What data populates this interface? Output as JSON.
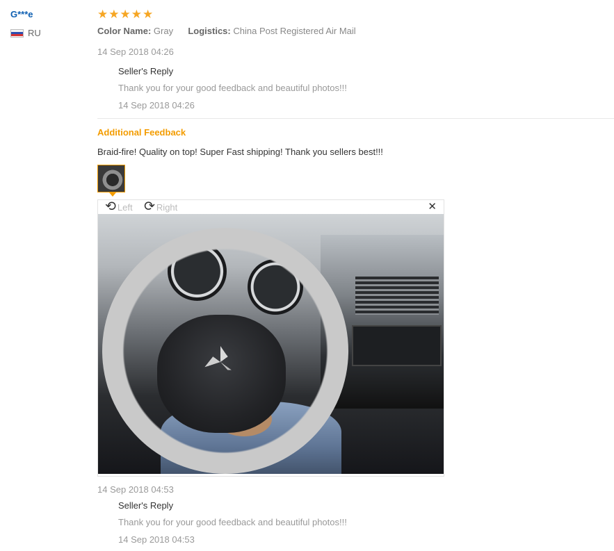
{
  "reviewer": {
    "name": "G***e",
    "country": "RU"
  },
  "rating": {
    "stars": 5
  },
  "attributes": {
    "color_key": "Color Name:",
    "color_value": "Gray",
    "logistics_key": "Logistics:",
    "logistics_value": "China Post Registered Air Mail"
  },
  "feedback": {
    "date": "14 Sep 2018 04:26",
    "seller_reply": {
      "title": "Seller's Reply",
      "text": "Thank you for your good feedback and beautiful photos!!!",
      "date": "14 Sep 2018 04:26"
    }
  },
  "additional_feedback": {
    "title": "Additional Feedback",
    "text": "Braid-fire! Quality on top! Super Fast shipping! Thank you sellers best!!!",
    "viewer": {
      "rotate_left": "Left",
      "rotate_right": "Right"
    },
    "date": "14 Sep 2018 04:53",
    "seller_reply": {
      "title": "Seller's Reply",
      "text": "Thank you for your good feedback and beautiful photos!!!",
      "date": "14 Sep 2018 04:53"
    }
  },
  "colors": {
    "name_blue": "#0e5fb2",
    "star_orange": "#f6a623",
    "accent_orange": "#f39c00"
  }
}
